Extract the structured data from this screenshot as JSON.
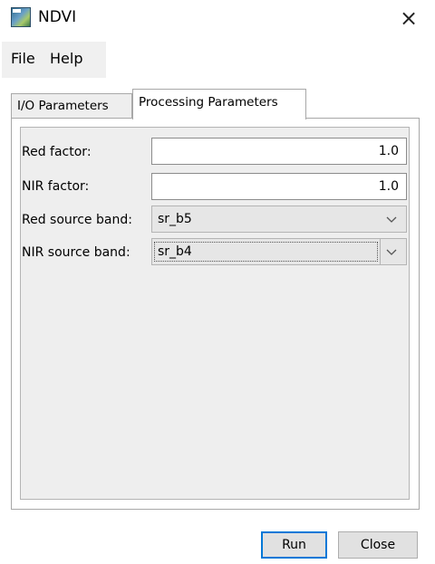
{
  "window": {
    "title": "NDVI",
    "close_glyph": "×",
    "app_icon": "snap-satellite-icon"
  },
  "menu": {
    "items": [
      {
        "label": "File"
      },
      {
        "label": "Help"
      }
    ]
  },
  "tabs": [
    {
      "label": "I/O Parameters",
      "selected": false
    },
    {
      "label": "Processing Parameters",
      "selected": true
    }
  ],
  "form": {
    "red_factor": {
      "label": "Red factor:",
      "value": "1.0"
    },
    "nir_factor": {
      "label": "NIR factor:",
      "value": "1.0"
    },
    "red_source_band": {
      "label": "Red source band:",
      "value": "sr_b5"
    },
    "nir_source_band": {
      "label": "NIR source band:",
      "value": "sr_b4"
    }
  },
  "buttons": {
    "run": "Run",
    "close": "Close"
  },
  "colors": {
    "focus_accent": "#0078d7",
    "menubar_bg": "#f0f0f0",
    "panel_bg": "#eeeeee"
  }
}
